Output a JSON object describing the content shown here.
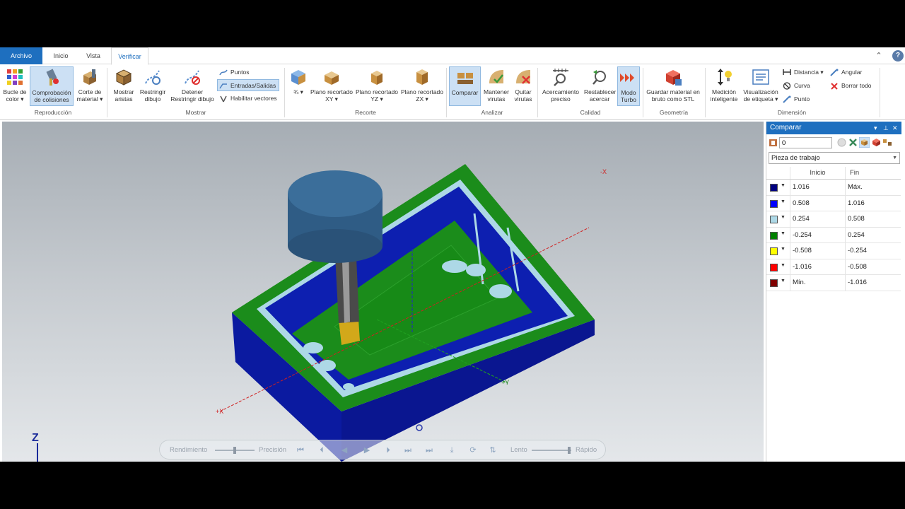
{
  "tabs": {
    "file": "Archivo",
    "inicio": "Inicio",
    "vista": "Vista",
    "verificar": "Verificar"
  },
  "ribbon": {
    "bucle": "Bucle de color ▾",
    "comprobacion": "Comprobación de colisiones",
    "corte": "Corte de material ▾",
    "mostrar_aristas": "Mostrar aristas",
    "restringir": "Restringir dibujo",
    "detener": "Detener Restringir dibujo",
    "puntos": "Puntos",
    "entradas": "Entradas/Salidas",
    "habilitar": "Habilitar vectores",
    "frac": "¾ ▾",
    "plano_xy": "Plano recortado XY ▾",
    "plano_yz": "Plano recortado YZ ▾",
    "plano_zx": "Plano recortado ZX ▾",
    "comparar": "Comparar",
    "mantener": "Mantener virutas",
    "quitar": "Quitar virutas",
    "acercamiento": "Acercamiento preciso",
    "restablecer": "Restablecer acercar",
    "turbo": "Modo Turbo",
    "guardar": "Guardar material en bruto como STL",
    "medicion": "Medición inteligente",
    "visualizacion": "Visualización de etiqueta ▾",
    "distancia": "Distancia ▾",
    "curva": "Curva",
    "punto": "Punto",
    "angular": "Angular",
    "borrar": "Borrar todo",
    "groups": {
      "reproduccion": "Reproducción",
      "mostrar": "Mostrar",
      "recorte": "Recorte",
      "analizar": "Analizar",
      "calidad": "Calidad",
      "geometria": "Geometría",
      "dimension": "Dimensión"
    }
  },
  "viewport": {
    "axis_labels": {
      "neg_x": "-X",
      "pos_x": "+X",
      "pos_y": "+Y",
      "z": "Z"
    },
    "simbar": {
      "rendimiento": "Rendimiento",
      "precision": "Precisión",
      "lento": "Lento",
      "rapido": "Rápido"
    }
  },
  "panel": {
    "title": "Comparar",
    "value": "0",
    "combo": "Pieza de trabajo",
    "headers": {
      "inicio": "Inicio",
      "fin": "Fin"
    },
    "rows": [
      {
        "color": "#000080",
        "inicio": "1.016",
        "fin": "Máx."
      },
      {
        "color": "#0000ff",
        "inicio": "0.508",
        "fin": "1.016"
      },
      {
        "color": "#add8e6",
        "inicio": "0.254",
        "fin": "0.508"
      },
      {
        "color": "#008000",
        "inicio": "-0.254",
        "fin": "0.254"
      },
      {
        "color": "#ffff00",
        "inicio": "-0.508",
        "fin": "-0.254"
      },
      {
        "color": "#ff0000",
        "inicio": "-1.016",
        "fin": "-0.508"
      },
      {
        "color": "#800000",
        "inicio": "Mín.",
        "fin": "-1.016"
      }
    ]
  }
}
